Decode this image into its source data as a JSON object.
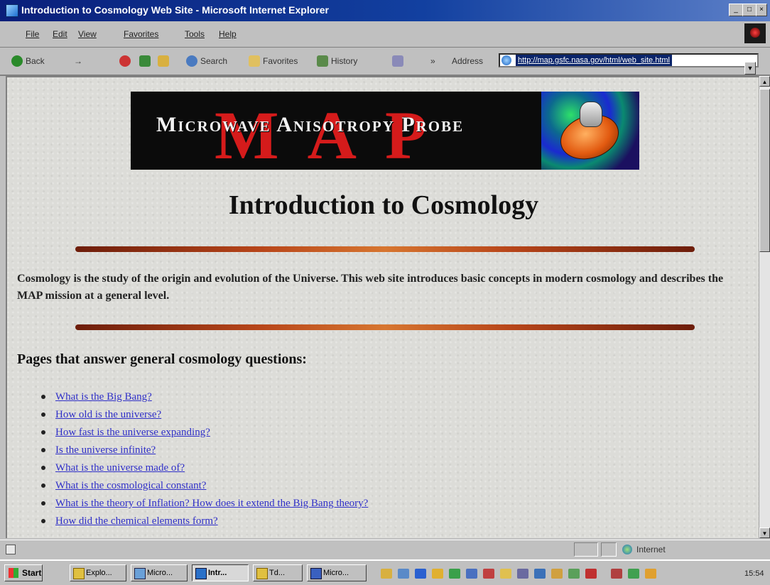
{
  "window": {
    "title": "Introduction to Cosmology Web Site - Microsoft Internet Explorer",
    "controls": [
      "_",
      "□",
      "×"
    ]
  },
  "menu": [
    "File",
    "Edit",
    "View",
    "Favorites",
    "Tools",
    "Help"
  ],
  "toolbar": {
    "back": "Back",
    "forward": "→",
    "search": "Search",
    "favorites": "Favorites",
    "history": "History",
    "more": "»",
    "address_label": "Address",
    "address_url": "http://map.gsfc.nasa.gov/html/web_site.html"
  },
  "banner": {
    "subtitle": "Microwave Anisotropy Probe",
    "letters": "MAP"
  },
  "page": {
    "title": "Introduction to Cosmology",
    "intro": "Cosmology is the study of the origin and evolution of the Universe. This web site introduces basic concepts in modern cosmology and describes the MAP mission at a general level.",
    "section_heading": "Pages that answer general cosmology questions:",
    "questions": [
      "What is the Big Bang?",
      "How old is the universe?",
      "How fast is the universe expanding?",
      "Is the universe infinite?",
      "What is the universe made of?",
      "What is the cosmological constant?",
      "What is the theory of Inflation? How does it extend the Big Bang theory?",
      "How did the chemical elements form?"
    ]
  },
  "status": {
    "zone": "Internet"
  },
  "taskbar": {
    "start": "Start",
    "buttons": [
      "Explo...",
      "Micro...",
      "Intr...",
      "Td...",
      "Micro..."
    ],
    "clock": "15:54"
  }
}
